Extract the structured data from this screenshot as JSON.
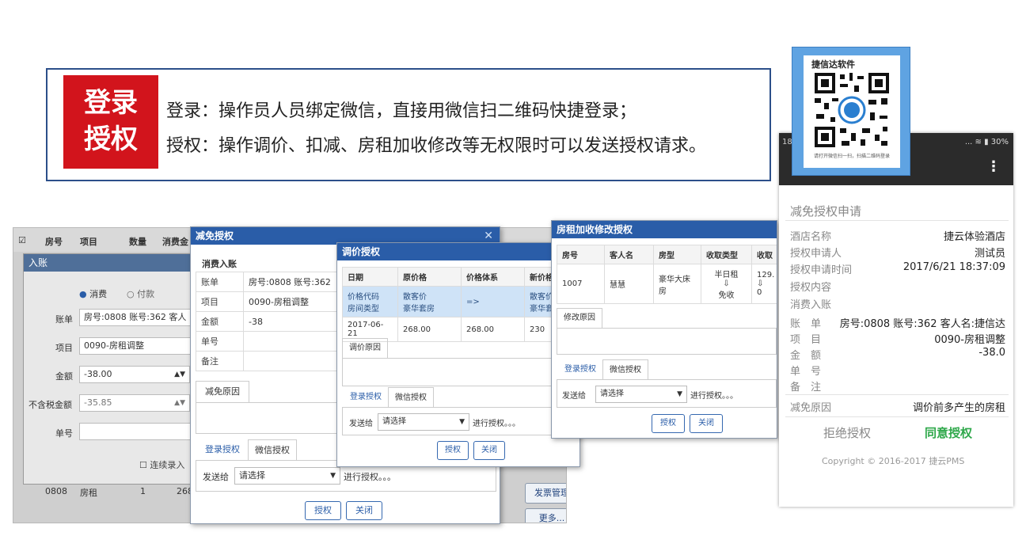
{
  "banner": {
    "badge_line1": "登录",
    "badge_line2": "授权",
    "line1": "登录：操作员人员绑定微信，直接用微信扫二维码快捷登录；",
    "line2": "授权：操作调价、扣减、房租加收修改等无权限时可以发送授权请求。"
  },
  "bgwin": {
    "headers": [
      "房号",
      "项目",
      "数量",
      "消费金"
    ],
    "title": "入账",
    "radio_consume": "消费",
    "radio_pay": "付款",
    "bill_label": "账单",
    "bill_value": "房号:0808  账号:362  客人",
    "item_label": "项目",
    "item_value": "0090-房租调整",
    "amount_label": "金额",
    "amount_value": "-38.00",
    "notax_label": "不含税金额",
    "notax_value": "-35.85",
    "no_label": "单号",
    "continuous": "连续录入",
    "row_room": "0808",
    "row_item": "房租",
    "row_qty": "1",
    "row_amt": "268"
  },
  "side_buttons": [
    "发票管理",
    "更多..."
  ],
  "dlg_reduce": {
    "title": "减免授权",
    "section": "消费入账",
    "rows": [
      {
        "label": "账单",
        "value": "房号:0808  账号:362"
      },
      {
        "label": "项目",
        "value": "0090-房租调整"
      },
      {
        "label": "金额",
        "value": "-38"
      },
      {
        "label": "单号",
        "value": ""
      },
      {
        "label": "备注",
        "value": ""
      }
    ],
    "reason_label": "减免原因",
    "tab_login": "登录授权",
    "tab_wechat": "微信授权",
    "send_to": "发送给",
    "select_placeholder": "请选择",
    "progress": "进行授权。。。",
    "btn_auth": "授权",
    "btn_close": "关闭"
  },
  "dlg_price": {
    "title": "调价授权",
    "headers": [
      "日期",
      "原价格",
      "价格体系",
      "新价格"
    ],
    "row1": {
      "c1a": "价格代码",
      "c1b": "房间类型",
      "c2a": "散客价",
      "c2b": "豪华套房",
      "c3": "=>",
      "c4a": "散客价",
      "c4b": "豪华套"
    },
    "row2": {
      "c1": "2017-06-21",
      "c2": "268.00",
      "c3": "268.00",
      "c4": "230"
    },
    "reason_label": "调价原因",
    "tab_login": "登录授权",
    "tab_wechat": "微信授权",
    "send_to": "发送给",
    "select_placeholder": "请选择",
    "progress": "进行授权。。。",
    "btn_auth": "授权",
    "btn_close": "关闭"
  },
  "dlg_rent": {
    "title": "房租加收修改授权",
    "headers": [
      "房号",
      "客人名",
      "房型",
      "收取类型",
      "收取"
    ],
    "row": {
      "room": "1007",
      "guest": "慧慧",
      "type": "豪华大床房",
      "charge_a": "半日租",
      "charge_b": "⇩",
      "charge_c": "免收",
      "amt_a": "129.",
      "amt_b": "⇩",
      "amt_c": "0"
    },
    "reason_label": "修改原因",
    "tab_login": "登录授权",
    "tab_wechat": "微信授权",
    "send_to": "发送给",
    "select_placeholder": "请选择",
    "progress": "进行授权。。。",
    "btn_auth": "授权",
    "btn_close": "关闭"
  },
  "qr": {
    "title": "捷信达软件",
    "caption": "请打开微信扫一扫，扫描二维码登录"
  },
  "phone": {
    "status_time": "18",
    "status_right": "... ≋ ▮ 30%",
    "heading": "减免授权申请",
    "rows": [
      {
        "label": "酒店名称",
        "value": "捷云体验酒店"
      },
      {
        "label": "授权申请人",
        "value": "测试员"
      },
      {
        "label": "授权申请时间",
        "value": "2017/6/21 18:37:09"
      },
      {
        "label": "授权内容",
        "value": ""
      },
      {
        "label": "消费入账",
        "value": ""
      },
      {
        "label": "账　单",
        "value": "房号:0808 账号:362 客人名:捷信达"
      },
      {
        "label": "项　目",
        "value": "0090-房租调整"
      },
      {
        "label": "金　额",
        "value": "-38.0"
      },
      {
        "label": "单　号",
        "value": ""
      },
      {
        "label": "备　注",
        "value": ""
      }
    ],
    "reason_label": "减免原因",
    "reason_value": "调价前多产生的房租",
    "reject": "拒绝授权",
    "agree": "同意授权",
    "copyright": "Copyright © 2016-2017 捷云PMS"
  },
  "colors": {
    "accent": "#2a5da8",
    "badge": "#d2141c",
    "agree": "#2ea84a"
  }
}
